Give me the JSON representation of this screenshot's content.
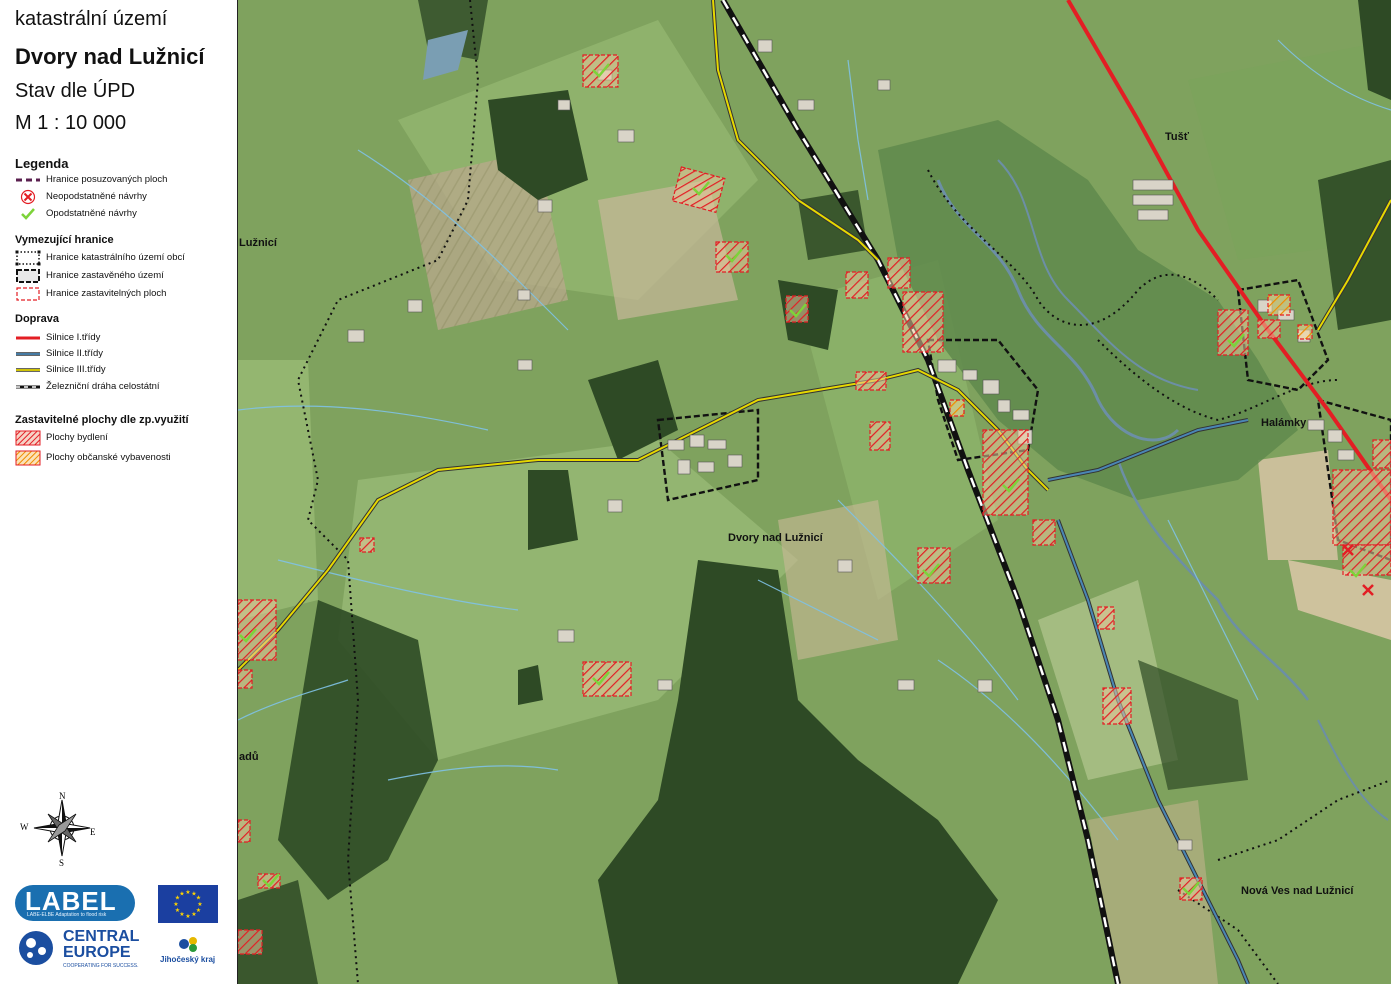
{
  "header": {
    "kind": "katastrální území",
    "name": "Dvory nad Lužnicí",
    "state": "Stav dle ÚPD",
    "scale": "M 1 : 10 000"
  },
  "legend": {
    "title": "Legenda",
    "items": [
      {
        "label": "Hranice posuzovaných ploch",
        "icon": "purple-dash-line"
      },
      {
        "label": "Neopodstatněné návrhy",
        "icon": "red-cross-icon"
      },
      {
        "label": "Opodstatněné návrhy",
        "icon": "green-check-icon"
      }
    ],
    "boundaries_title": "Vymezující hranice",
    "boundaries": [
      {
        "label": "Hranice katastrálního území obcí",
        "icon": "black-dotted-line"
      },
      {
        "label": "Hranice zastavěného území",
        "icon": "black-dashed-box"
      },
      {
        "label": "Hranice zastavitelných ploch",
        "icon": "red-dashed-box"
      }
    ],
    "transport_title": "Doprava",
    "transport": [
      {
        "label": "Silnice I.třídy",
        "color": "#e31e24"
      },
      {
        "label": "Silnice II.třídy",
        "color": "#4a86b4"
      },
      {
        "label": "Silnice III.třídy",
        "color": "#e6d800"
      },
      {
        "label": "Železniční dráha celostátní",
        "icon": "railway-line"
      }
    ],
    "zones_title": "Zastavitelné plochy dle zp.využití",
    "zones": [
      {
        "label": "Plochy bydlení",
        "color": "#e31e24"
      },
      {
        "label": "Plochy občanské vybavenosti",
        "color": "#f08c00"
      }
    ]
  },
  "compass": {
    "n": "N",
    "s": "S",
    "e": "E",
    "w": "W"
  },
  "map": {
    "places": [
      {
        "name": "Tušť"
      },
      {
        "name": "Halámky"
      },
      {
        "name": "Dvory nad Lužnicí"
      },
      {
        "name": "Nová Ves nad Lužnicí"
      },
      {
        "name": "Lužnicí"
      },
      {
        "name": "adů"
      }
    ]
  },
  "logos": {
    "label_name": "LABEL",
    "label_tagline": "LABE-ELBE Adaptation to flood risk",
    "central_europe": "CENTRAL EUROPE",
    "central_europe_tagline": "COOPERATING FOR SUCCESS.",
    "region": "Jihočeský kraj"
  },
  "colors": {
    "road1": "#e31e24",
    "road2": "#4a86b4",
    "road3": "#e6d800",
    "housing": "#e31e24",
    "civic": "#f08c00",
    "approved": "#7dd33a"
  }
}
